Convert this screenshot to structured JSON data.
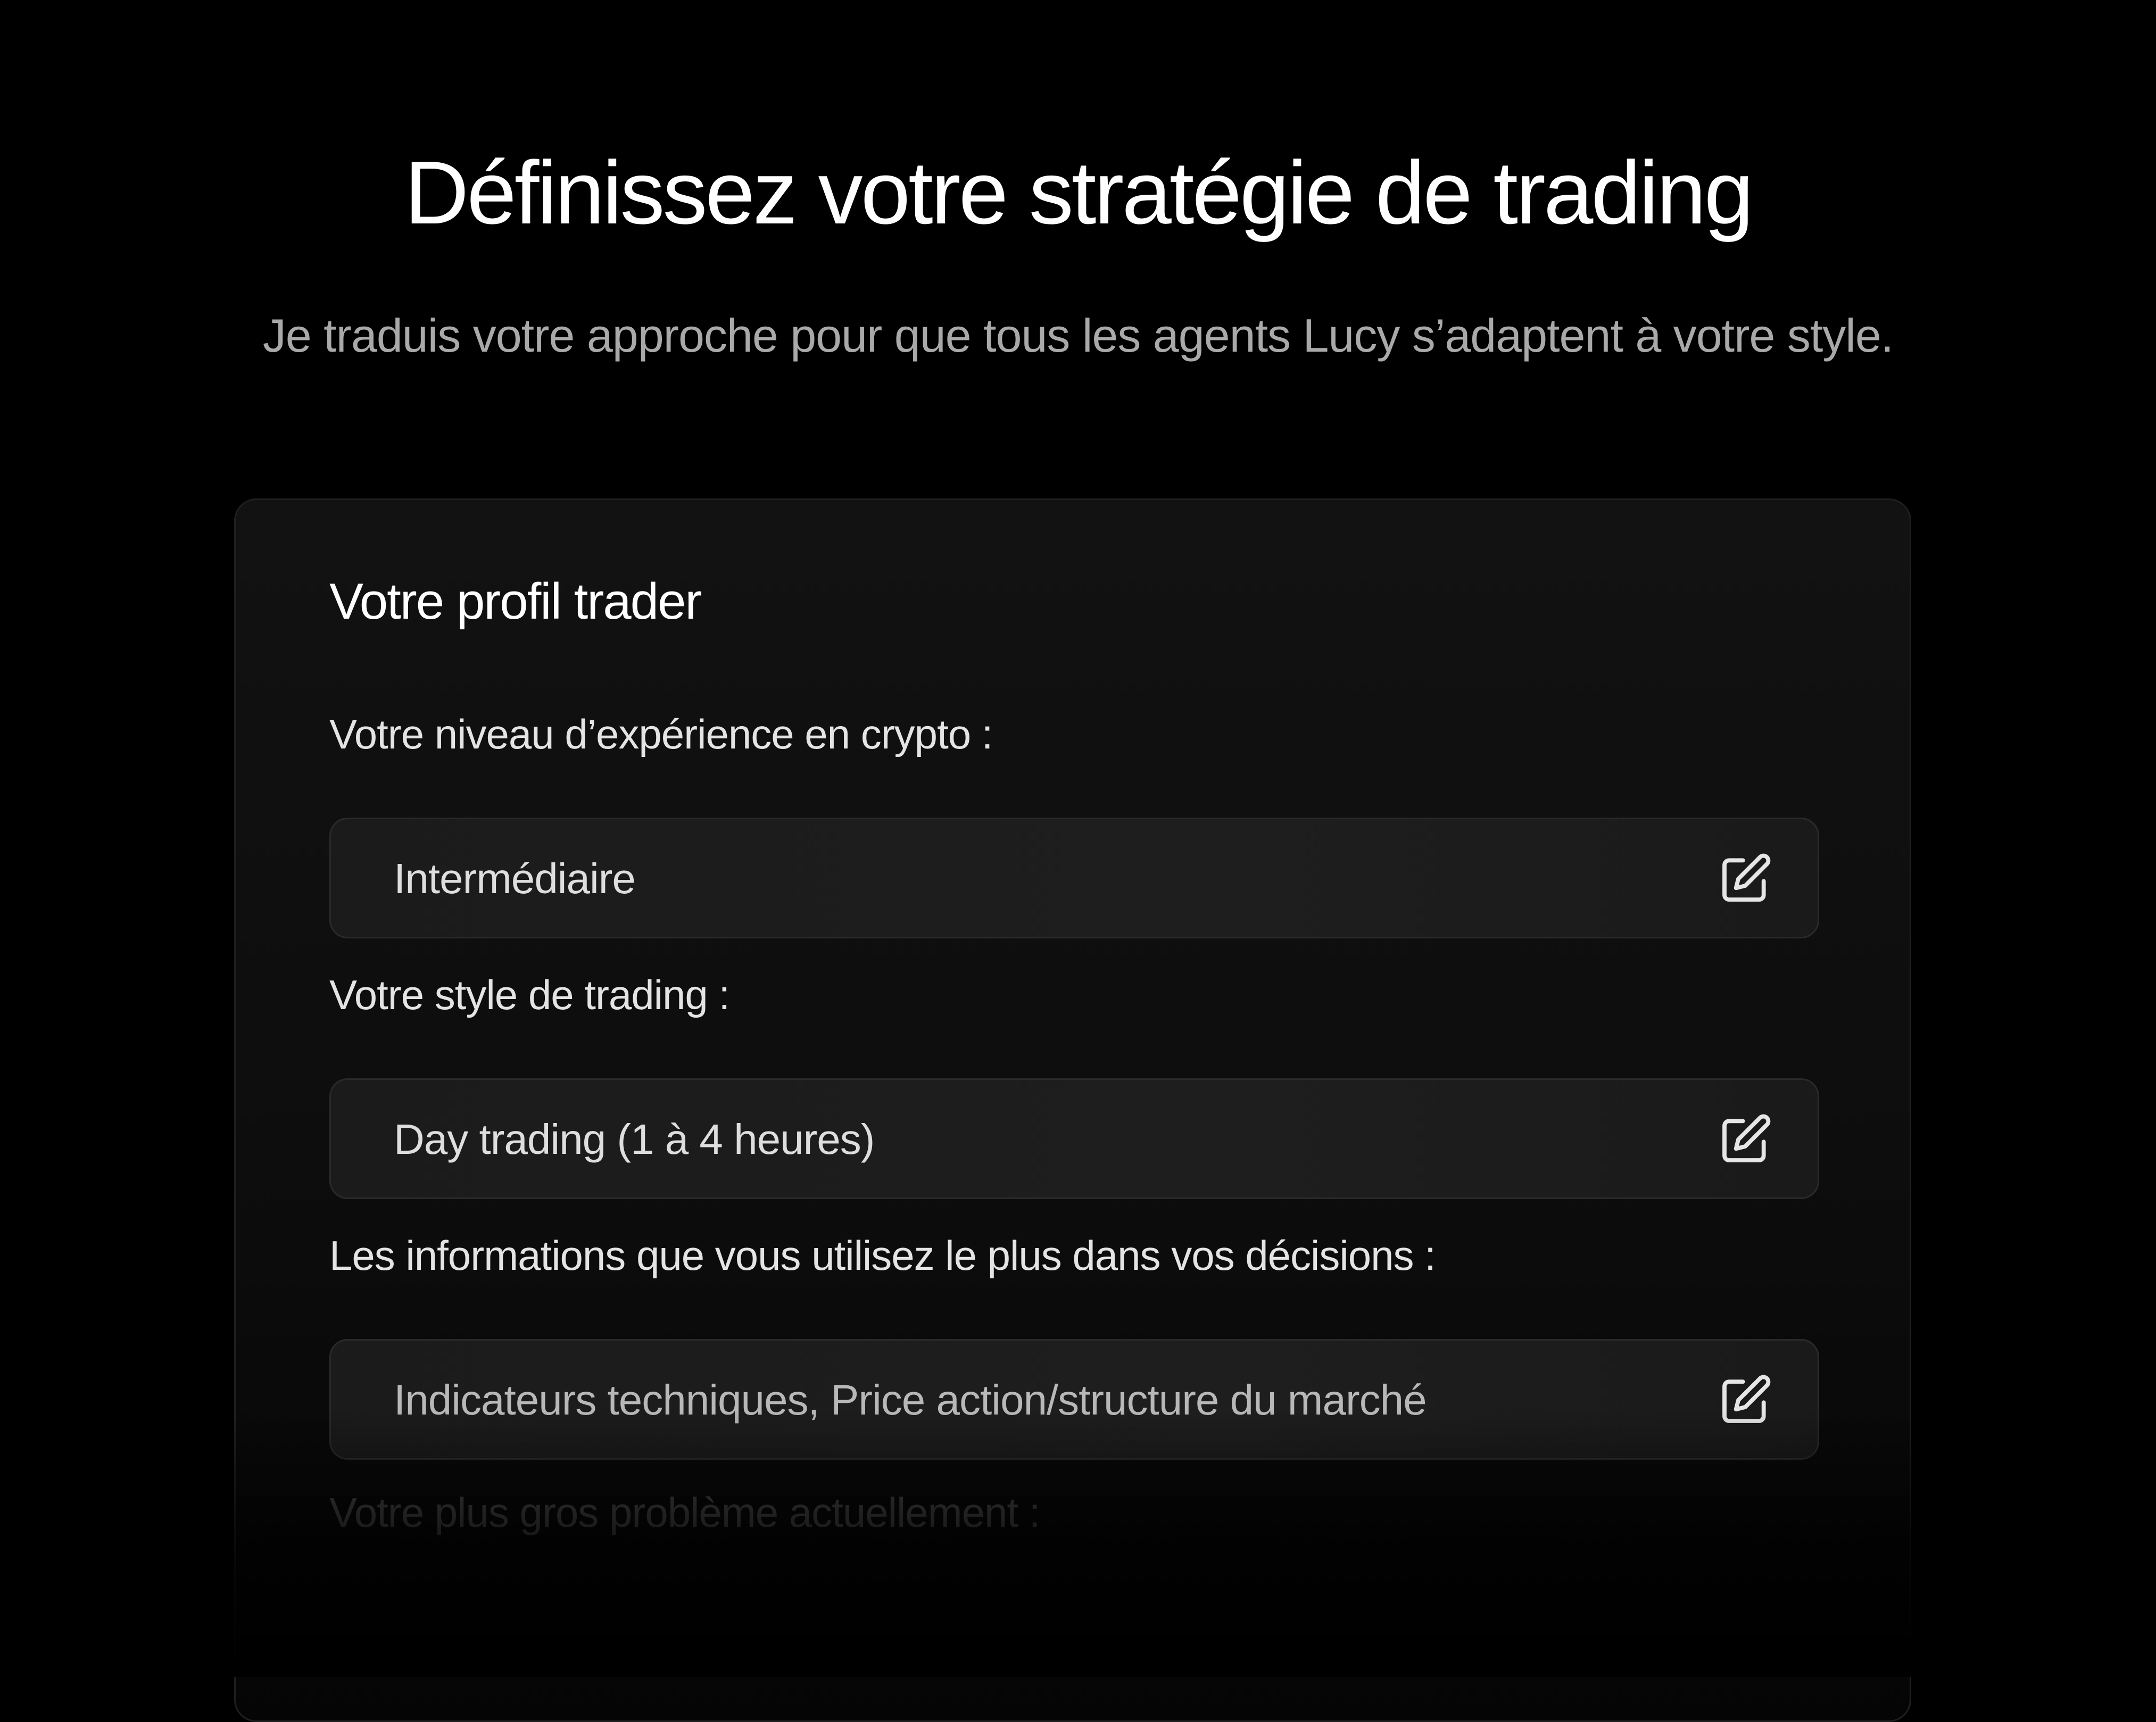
{
  "header": {
    "title": "Définissez votre stratégie de trading",
    "subtitle": "Je traduis votre approche pour que tous les agents Lucy s’adaptent à votre style."
  },
  "profile_card": {
    "title": "Votre profil trader",
    "fields": [
      {
        "label": "Votre niveau d’expérience en crypto :",
        "value": "Intermédiaire",
        "icon": "edit-icon"
      },
      {
        "label": "Votre style de trading :",
        "value": "Day trading (1 à 4 heures)",
        "icon": "edit-icon"
      },
      {
        "label": "Les informations que vous utilisez le plus dans vos décisions :",
        "value": "Indicateurs techniques, Price action/structure du marché",
        "icon": "edit-icon"
      },
      {
        "label": "Votre plus gros problème actuellement :"
      }
    ]
  },
  "colors": {
    "background": "#000000",
    "card_background": "#121212",
    "field_background": "#1e1e1e",
    "title_text": "#ffffff",
    "subtitle_text": "#a9a9a9"
  }
}
